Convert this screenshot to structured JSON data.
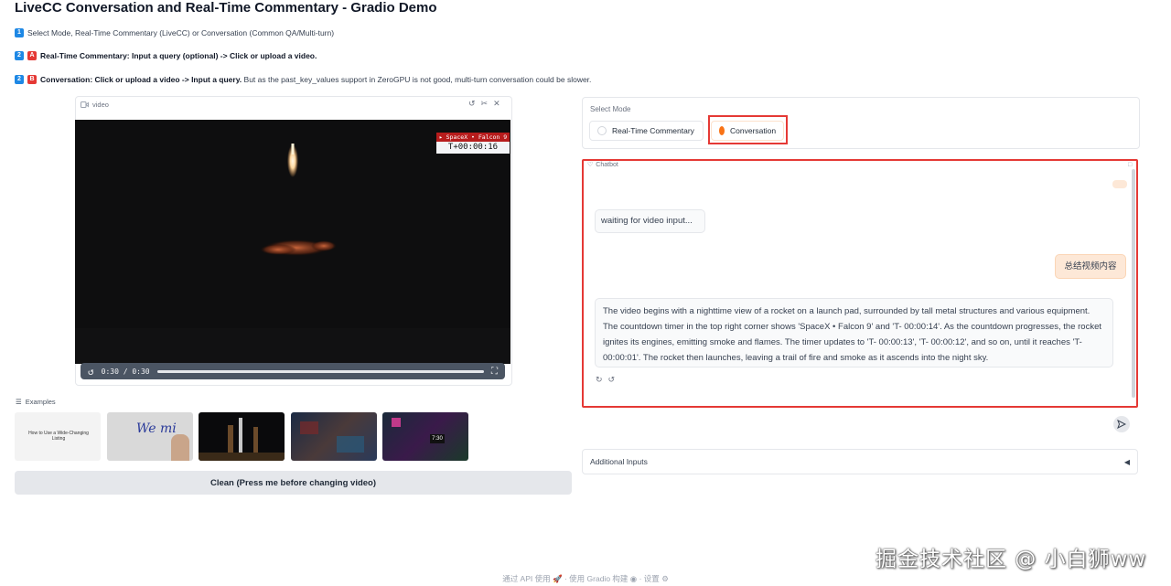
{
  "page": {
    "title": "LiveCC Conversation and Real-Time Commentary - Gradio Demo"
  },
  "steps": [
    {
      "badges": [
        "1"
      ],
      "text": "Select Mode, Real-Time Commentary (LiveCC) or Conversation (Common QA/Multi-turn)"
    },
    {
      "badges": [
        "2",
        "A"
      ],
      "bold": "Real-Time Commentary: Input a query (optional) -> Click or upload a video.",
      "text": ""
    },
    {
      "badges": [
        "2",
        "B"
      ],
      "bold": "Conversation: Click or upload a video -> Input a query.",
      "text": " But as the past_key_values support in ZeroGPU is not good, multi-turn conversation could be slower."
    }
  ],
  "video": {
    "label": "video",
    "time_current": "0:30",
    "time_total": "0:30",
    "time_display": "0:30 / 0:30",
    "overlay_badge": "▸ SpaceX • Falcon 9",
    "overlay_timer": "T+00:00:16",
    "progress": 1.0
  },
  "examples": {
    "label": "Examples",
    "items": [
      {
        "name": "example-whiteboard-text",
        "text": "How to Use a Wide-Changing Listing"
      },
      {
        "name": "example-handwriting",
        "text": "We mi"
      },
      {
        "name": "example-rocket-launchpad",
        "text": ""
      },
      {
        "name": "example-crowd-stadium",
        "text": ""
      },
      {
        "name": "example-esports-game",
        "text": "7:30"
      }
    ]
  },
  "clean_button": "Clean (Press me before changing video)",
  "mode": {
    "label": "Select Mode",
    "options": [
      "Real-Time Commentary",
      "Conversation"
    ],
    "selected": "Conversation"
  },
  "chat": {
    "label": "Chatbot",
    "messages": [
      {
        "role": "assistant",
        "text": "waiting for video input..."
      },
      {
        "role": "user",
        "text": "总结视频内容"
      },
      {
        "role": "assistant",
        "text": "The video begins with a nighttime view of a rocket on a launch pad, surrounded by tall metal structures and various equipment. The countdown timer in the top right corner shows 'SpaceX • Falcon 9' and 'T- 00:00:14'. As the countdown progresses, the rocket ignites its engines, emitting smoke and flames. The timer updates to 'T- 00:00:13', 'T- 00:00:12', and so on, until it reaches 'T- 00:00:01'. The rocket then launches, leaving a trail of fire and smoke as it ascends into the night sky."
      }
    ]
  },
  "additional_inputs": "Additional Inputs",
  "footer": {
    "api": "通过 API 使用",
    "built": "使用 Gradio 构建",
    "settings": "设置"
  },
  "watermark": "掘金技术社区 @ 小白狮ww",
  "colors": {
    "accent": "#f97316",
    "highlight": "#e53935",
    "step_badge_blue": "#1e88e5",
    "step_badge_red": "#e53935"
  }
}
